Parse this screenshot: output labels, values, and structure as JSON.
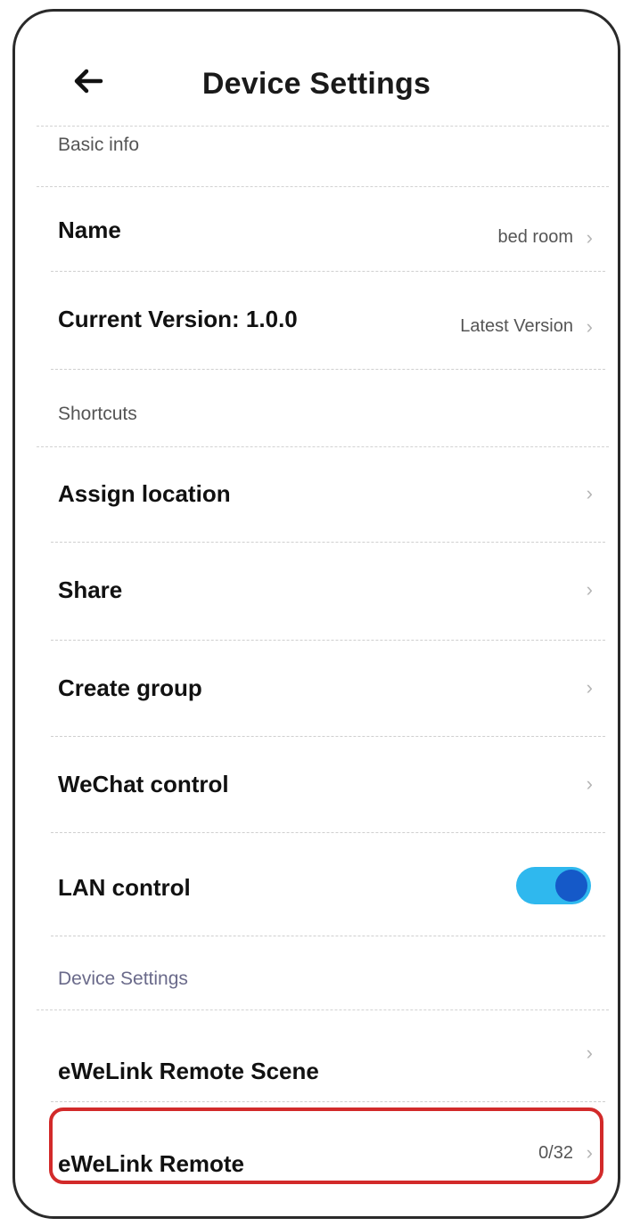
{
  "header": {
    "title": "Device Settings"
  },
  "sections": {
    "basic_info": "Basic info",
    "shortcuts": "Shortcuts",
    "device_settings": "Device Settings"
  },
  "rows": {
    "name": {
      "label": "Name",
      "value": "bed room"
    },
    "version": {
      "label": "Current Version:  1.0.0",
      "value": "Latest Version"
    },
    "assign_location": {
      "label": "Assign location"
    },
    "share": {
      "label": "Share"
    },
    "create_group": {
      "label": "Create group"
    },
    "wechat_control": {
      "label": "WeChat control"
    },
    "lan_control": {
      "label": "LAN control",
      "enabled": true
    },
    "remote_scene": {
      "label": "eWeLink Remote Scene"
    },
    "remote": {
      "label": "eWeLink Remote",
      "value": "0/32"
    }
  },
  "icons": {
    "back": "arrow-left-icon",
    "chevron": "chevron-right-icon"
  },
  "colors": {
    "toggle_track": "#2fb8ee",
    "toggle_knob": "#1559c8",
    "highlight": "#d22a2a"
  }
}
